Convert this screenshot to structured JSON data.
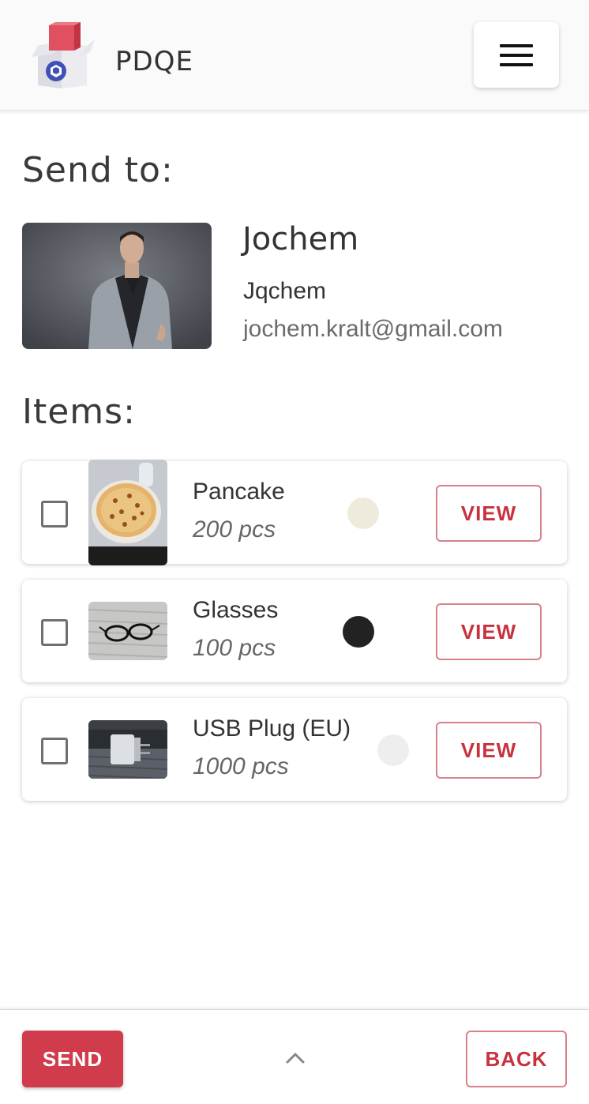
{
  "app": {
    "brand": "PDQE",
    "logo_icon": "package-box-icon"
  },
  "header": {
    "menu_icon": "hamburger-menu-icon"
  },
  "send_to": {
    "title": "Send to:",
    "recipient": {
      "name": "Jochem",
      "username": "Jqchem",
      "email": "jochem.kralt@gmail.com"
    }
  },
  "items": {
    "title": "Items:",
    "list": [
      {
        "name": "Pancake",
        "quantity": "200 pcs",
        "color": "#efebdc",
        "view_label": "VIEW",
        "checked": false
      },
      {
        "name": "Glasses",
        "quantity": "100 pcs",
        "color": "#222222",
        "view_label": "VIEW",
        "checked": false
      },
      {
        "name": "USB Plug (EU)",
        "quantity": "1000 pcs",
        "color": "#eeeeee",
        "view_label": "VIEW",
        "checked": false
      }
    ]
  },
  "footer": {
    "send_label": "SEND",
    "back_label": "BACK",
    "expand_icon": "chevron-up-icon"
  },
  "colors": {
    "accent": "#d03c4b",
    "accent_outline": "#d9808a",
    "accent_text": "#c8323e"
  }
}
